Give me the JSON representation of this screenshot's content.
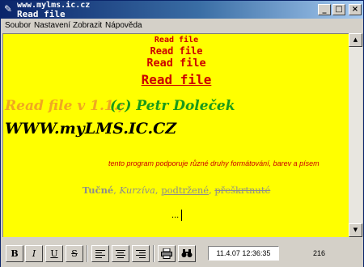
{
  "window": {
    "title_url": "www.mylms.ic.cz",
    "title": "Read file",
    "icon": "pen-icon",
    "controls": {
      "minimize": "_",
      "maximize": "□",
      "close": "×"
    }
  },
  "menu": {
    "items": [
      "Soubor",
      "Nastavení",
      "Zobrazit",
      "Nápověda"
    ]
  },
  "editor": {
    "background": "#ffff00",
    "headings": [
      "Read file",
      "Read file",
      "Read file",
      "Read file"
    ],
    "version_text": "Read file v 1.1.;",
    "author_text": "(c) Petr Doleček",
    "website": "WWW.myLMS.IC.CZ",
    "info": "tento program podporuje různé druhy formátování, barev a písem",
    "styles": {
      "bold": "Tučné",
      "italic": "Kurzíva",
      "underline": "podtržené",
      "strike": "přeškrtnuté",
      "sep": ", "
    },
    "dots": "..."
  },
  "toolbar": {
    "bold": "B",
    "italic": "I",
    "underline": "U",
    "strike": "S",
    "datetime": "11.4.07 12:36:35",
    "count": "216"
  },
  "colors": {
    "heading": "#cc0000",
    "version": "#f0a820",
    "author": "#1a9a1a",
    "info": "#cc0000",
    "styles": "#8c8c8c"
  }
}
